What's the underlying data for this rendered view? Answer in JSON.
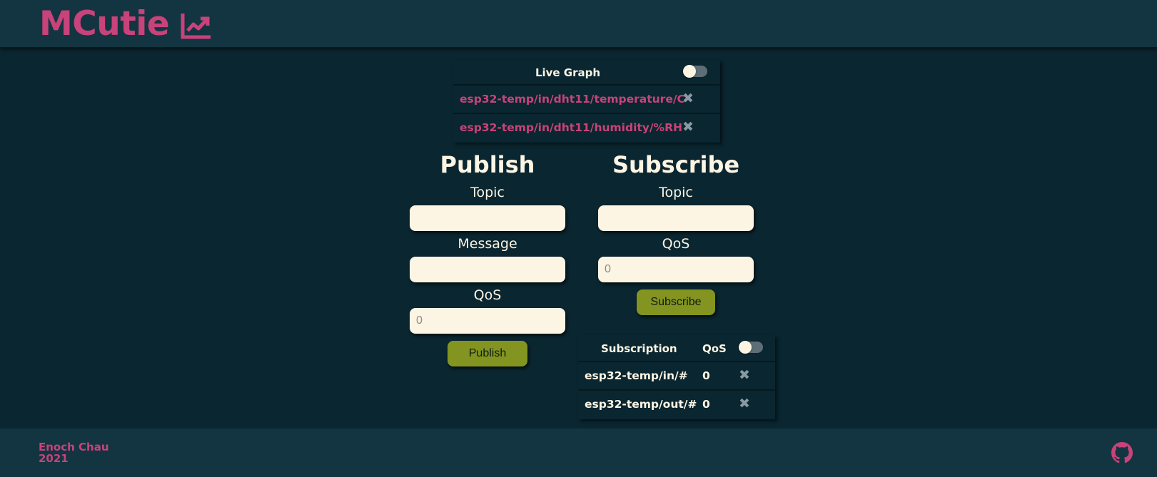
{
  "header": {
    "title": "MCutie",
    "icon": "chart-line-icon",
    "accent_color": "#c8437a"
  },
  "live_graph": {
    "header_label": "Live Graph",
    "toggle_on": false,
    "topics": [
      {
        "topic": "esp32-temp/in/dht11/temperature/C"
      },
      {
        "topic": "esp32-temp/in/dht11/humidity/%RH"
      }
    ],
    "remove_icon": "close-icon"
  },
  "publish": {
    "title": "Publish",
    "topic_label": "Topic",
    "topic_value": "",
    "message_label": "Message",
    "message_value": "",
    "qos_label": "QoS",
    "qos_placeholder": "0",
    "button_label": "Publish"
  },
  "subscribe": {
    "title": "Subscribe",
    "topic_label": "Topic",
    "topic_value": "",
    "qos_label": "QoS",
    "qos_placeholder": "0",
    "button_label": "Subscribe"
  },
  "subscriptions": {
    "columns": [
      "Subscription",
      "QoS"
    ],
    "toggle_on": false,
    "rows": [
      {
        "topic": "esp32-temp/in/#",
        "qos": "0"
      },
      {
        "topic": "esp32-temp/out/#",
        "qos": "0"
      }
    ]
  },
  "footer": {
    "author": "Enoch Chau",
    "year": "2021",
    "github_icon": "github-icon"
  },
  "colors": {
    "background": "#0a2630",
    "bar": "#133441",
    "accent": "#c8437a",
    "button": "#849421",
    "input": "#fdf5e4"
  }
}
